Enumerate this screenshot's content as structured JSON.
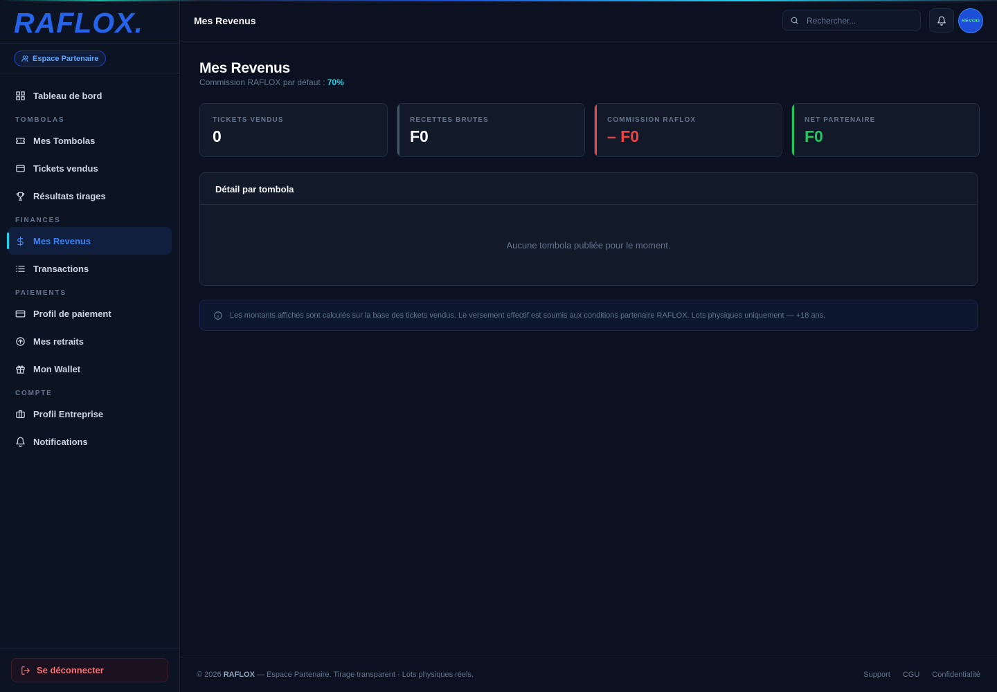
{
  "brand": {
    "logo": "RAFLOX."
  },
  "partner_badge": "Espace Partenaire",
  "sidebar": {
    "dashboard": "Tableau de bord",
    "sections": {
      "tombolas": "TOMBOLAS",
      "finances": "FINANCES",
      "paiements": "PAIEMENTS",
      "compte": "COMPTE"
    },
    "tombolas_items": [
      "Mes Tombolas",
      "Tickets vendus",
      "Résultats tirages"
    ],
    "finances_items": [
      "Mes Revenus",
      "Transactions"
    ],
    "paiements_items": [
      "Profil de paiement",
      "Mes retraits",
      "Mon Wallet"
    ],
    "compte_items": [
      "Profil Entreprise",
      "Notifications"
    ],
    "logout": "Se déconnecter"
  },
  "header": {
    "title": "Mes Revenus",
    "search_placeholder": "Rechercher...",
    "avatar_text": "REVOO"
  },
  "page": {
    "title": "Mes Revenus",
    "subtitle_prefix": "Commission RAFLOX par défaut : ",
    "commission_rate": "70%"
  },
  "stats": [
    {
      "label": "TICKETS VENDUS",
      "value": "0",
      "accent": "#121a2a",
      "value_color": "#f8fafc"
    },
    {
      "label": "RECETTES BRUTES",
      "value": "F0",
      "accent": "#475569",
      "value_color": "#f8fafc"
    },
    {
      "label": "COMMISSION RAFLOX",
      "value": "– F0",
      "accent": "#ef4444",
      "value_color": "#ef4444"
    },
    {
      "label": "NET PARTENAIRE",
      "value": "F0",
      "accent": "#22c55e",
      "value_color": "#22c55e"
    }
  ],
  "detail": {
    "title": "Détail par tombola",
    "empty": "Aucune tombola publiée pour le moment."
  },
  "notice": "Les montants affichés sont calculés sur la base des tickets vendus. Le versement effectif est soumis aux conditions partenaire RAFLOX. Lots physiques uniquement — +18 ans.",
  "footer": {
    "prefix": "© 2026 ",
    "brand": "RAFLOX",
    "suffix": " — Espace Partenaire. Tirage transparent · Lots physiques réels.",
    "links": [
      "Support",
      "CGU",
      "Confidentialité"
    ]
  }
}
